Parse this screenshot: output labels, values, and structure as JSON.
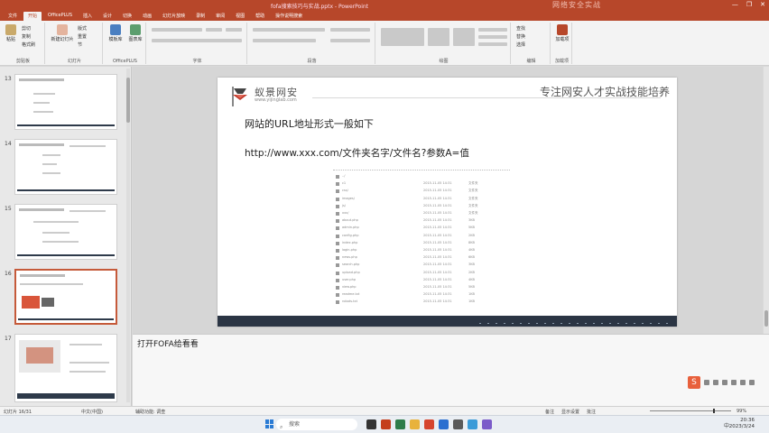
{
  "window": {
    "title": "fofa搜索技巧与实战.pptx - PowerPoint",
    "watermark": "网络安全实战",
    "controls": [
      "—",
      "❐",
      "✕"
    ]
  },
  "ribbon_tabs": [
    "文件",
    "开始",
    "OfficePLUS",
    "插入",
    "设计",
    "切换",
    "动画",
    "幻灯片放映",
    "录制",
    "审阅",
    "视图",
    "帮助",
    "操作说明搜索"
  ],
  "active_tab": "开始",
  "ribbon": {
    "clipboard": {
      "label": "剪贴板",
      "paste": "粘贴",
      "cut": "剪切",
      "copy": "复制",
      "format": "格式刷"
    },
    "slides": {
      "label": "幻灯片",
      "new": "新建幻灯片",
      "layout": "版式",
      "reset": "重置",
      "section": "节"
    },
    "officeplus": {
      "label": "OfficePLUS",
      "b1": "模板库",
      "b2": "图表库"
    },
    "font": {
      "label": "字体"
    },
    "paragraph": {
      "label": "段落"
    },
    "drawing": {
      "label": "绘图"
    },
    "editing": {
      "label": "编辑",
      "find": "查找",
      "replace": "替换",
      "select": "选择"
    },
    "addins": {
      "label": "加载项",
      "b1": "加载项"
    }
  },
  "thumbnails": [
    {
      "num": "13"
    },
    {
      "num": "14"
    },
    {
      "num": "15"
    },
    {
      "num": "16"
    },
    {
      "num": "17"
    }
  ],
  "slide": {
    "brand": "蚁景网安",
    "domain": "www.yijinglab.com",
    "slogan": "专注网安人才实战技能培养",
    "heading": "网站的URL地址形式一般如下",
    "url_pattern": "http://www.xxx.com/文件夹名字/文件名?参数A=值",
    "listing": [
      {
        "name": "../",
        "date": "",
        "size": ""
      },
      {
        "name": "c1",
        "date": "2015-11-05 14:31",
        "size": "文件夹"
      },
      {
        "name": "css/",
        "date": "2015-11-05 14:31",
        "size": "文件夹"
      },
      {
        "name": "images/",
        "date": "2015-11-05 14:31",
        "size": "文件夹"
      },
      {
        "name": "js/",
        "date": "2015-11-05 14:31",
        "size": "文件夹"
      },
      {
        "name": "xxx/",
        "date": "2015-11-05 14:31",
        "size": "文件夹"
      },
      {
        "name": "about.php",
        "date": "2015-11-05 14:31",
        "size": "3KB"
      },
      {
        "name": "admin.php",
        "date": "2015-11-05 14:31",
        "size": "5KB"
      },
      {
        "name": "config.php",
        "date": "2015-11-05 14:31",
        "size": "2KB"
      },
      {
        "name": "index.php",
        "date": "2015-11-05 14:31",
        "size": "8KB"
      },
      {
        "name": "login.php",
        "date": "2015-11-05 14:31",
        "size": "4KB"
      },
      {
        "name": "news.php",
        "date": "2015-11-05 14:31",
        "size": "6KB"
      },
      {
        "name": "search.php",
        "date": "2015-11-05 14:31",
        "size": "3KB"
      },
      {
        "name": "upload.php",
        "date": "2015-11-05 14:31",
        "size": "2KB"
      },
      {
        "name": "user.php",
        "date": "2015-11-05 14:31",
        "size": "4KB"
      },
      {
        "name": "view.php",
        "date": "2015-11-05 14:31",
        "size": "5KB"
      },
      {
        "name": "readme.txt",
        "date": "2015-11-05 14:31",
        "size": "1KB"
      },
      {
        "name": "robots.txt",
        "date": "2015-11-05 14:31",
        "size": "1KB"
      }
    ]
  },
  "notes": {
    "text": "打开FOFA给看看"
  },
  "status": {
    "slide_of": "幻灯片 16/31",
    "lang": "中文(中国)",
    "accessibility": "辅助功能: 调查",
    "notes_btn": "备注",
    "view_btn": "显示设置",
    "comments": "批注",
    "zoom": "99%"
  },
  "taskbar": {
    "search_placeholder": "搜索",
    "time": "20:36",
    "date": "2023/3/24",
    "lang": "中"
  }
}
